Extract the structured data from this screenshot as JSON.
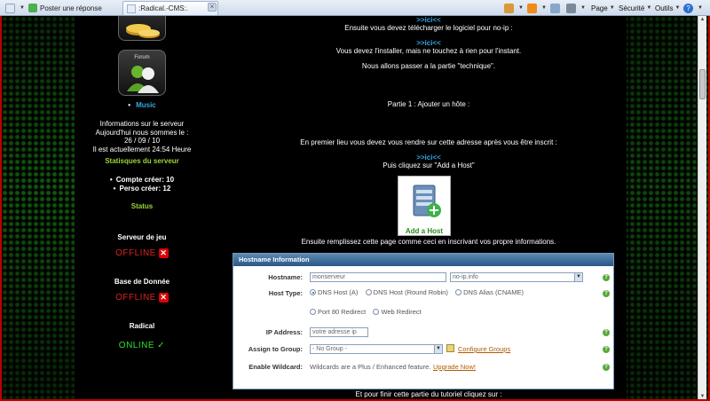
{
  "browser": {
    "tab1": {
      "label": "Poster une réponse",
      "icon": "page-icon"
    },
    "tab2": {
      "label": ":Radical.-CMS:.",
      "icon": "page-icon"
    },
    "tab_close": "×",
    "toolbar": {
      "page": "Page",
      "safety": "Sécurité",
      "tools": "Outils",
      "help": "?"
    }
  },
  "sidebar": {
    "forum_label": "Forum",
    "music_link": "Music",
    "server_info": {
      "title": "Informations sur le serveur",
      "date_intro": "Aujourd'hui nous sommes le :",
      "date": "26 / 09 / 10",
      "time": "Il est actuellement 24:54 Heure"
    },
    "stats": {
      "title": "Statisques du serveur",
      "accounts": "Compte créer: 10",
      "characters": "Perso créer: 12"
    },
    "status": {
      "title": "Status",
      "game_label": "Serveur de jeu",
      "game_state": "OFFLINE",
      "db_label": "Base de Donnée",
      "db_state": "OFFLINE",
      "radical_label": "Radical",
      "radical_state": "ONLINE ✓"
    }
  },
  "main": {
    "link1": ">>ici<<",
    "line_download": "Ensuite vous devez télécharger le logiciel pour no-ip :",
    "link2": ">>ici<<",
    "line_install": "Vous devez l'installer, mais ne touchez à rien pour l'instant.",
    "line_technical": "Nous allons passer a la partie \"technique\".",
    "part1": "Partie 1 : Ajouter un hôte :",
    "line_first": "En premier lieu vous devez vous rendre sur cette adresse après vous être inscrit :",
    "link3": ">>ici<<",
    "line_click": "Puis cliquez sur \"Add a Host\"",
    "addhost_label": "Add a Host",
    "line_fill": "Ensuite remplissez cette page comme ceci en inscrivant vos propre informations.",
    "line_finish": "Et pour finir cette partie du tutoriel cliquez sur :"
  },
  "form": {
    "header": "Hostname Information",
    "hostname_label": "Hostname:",
    "hostname_value": "monserveur",
    "domain_value": "no-ip.info",
    "hosttype_label": "Host Type:",
    "types": [
      "DNS Host (A)",
      "DNS Host (Round Robin)",
      "DNS Alias (CNAME)",
      "Port 80 Redirect",
      "Web Redirect"
    ],
    "selected_type": "DNS Host (A)",
    "ip_label": "IP Address:",
    "ip_value": "votre adresse ip",
    "group_label": "Assign to Group:",
    "group_value": "- No Group -",
    "configure_groups": "Configure Groups",
    "wildcard_label": "Enable Wildcard:",
    "wildcard_text": "Wildcards are a Plus / Enhanced feature.",
    "upgrade_link": "Upgrade Now!",
    "help_glyph": "?"
  },
  "colors": {
    "accent_link": "#35a8e0",
    "status_green": "#2fe02f",
    "status_red": "#e02020",
    "title_green": "#9bd43a",
    "form_header": "#2b5787"
  }
}
